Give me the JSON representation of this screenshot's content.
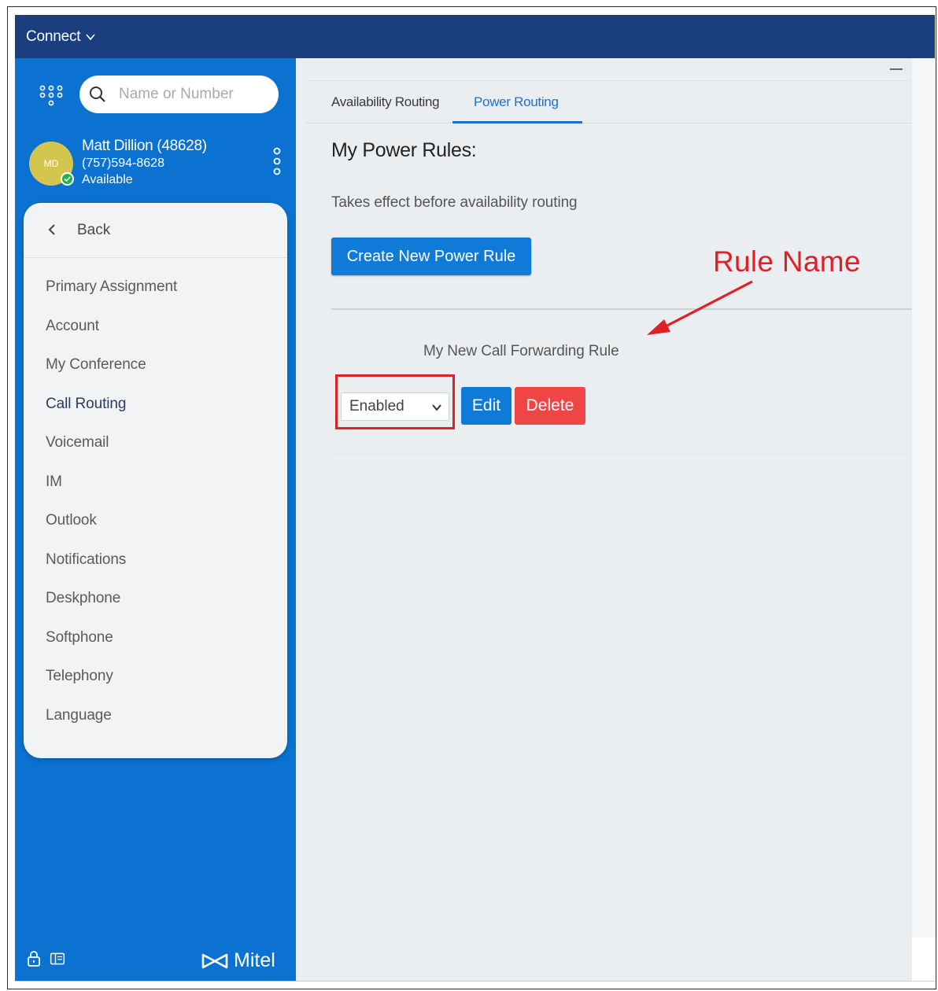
{
  "titlebar": {
    "app_title": "Connect"
  },
  "sidebar": {
    "search": {
      "placeholder": "Name or Number"
    },
    "user": {
      "initials": "MD",
      "name": "Matt Dillion (48628)",
      "number": "(757)594-8628",
      "status": "Available"
    },
    "back_label": "Back",
    "menu_items": [
      {
        "label": "Primary Assignment"
      },
      {
        "label": "Account"
      },
      {
        "label": "My Conference"
      },
      {
        "label": "Call Routing",
        "active": true
      },
      {
        "label": "Voicemail"
      },
      {
        "label": "IM"
      },
      {
        "label": "Outlook"
      },
      {
        "label": "Notifications"
      },
      {
        "label": "Deskphone"
      },
      {
        "label": "Softphone"
      },
      {
        "label": "Telephony"
      },
      {
        "label": "Language"
      }
    ],
    "brand": "Mitel"
  },
  "main": {
    "tabs": [
      {
        "label": "Availability Routing",
        "active": false
      },
      {
        "label": "Power Routing",
        "active": true
      }
    ],
    "section_title": "My Power Rules:",
    "section_description": "Takes effect before availability routing",
    "create_button": "Create New Power Rule",
    "rule": {
      "name": "My New Call Forwarding Rule",
      "status": "Enabled",
      "edit_label": "Edit",
      "delete_label": "Delete"
    }
  },
  "annotation": {
    "label": "Rule Name",
    "color": "#e01f26"
  },
  "colors": {
    "titlebar": "#1b3f7e",
    "sidebar": "#0b72d2",
    "primary_button": "#0f7ad8",
    "delete_button": "#f04545",
    "active_tab": "#1f6fd0"
  }
}
